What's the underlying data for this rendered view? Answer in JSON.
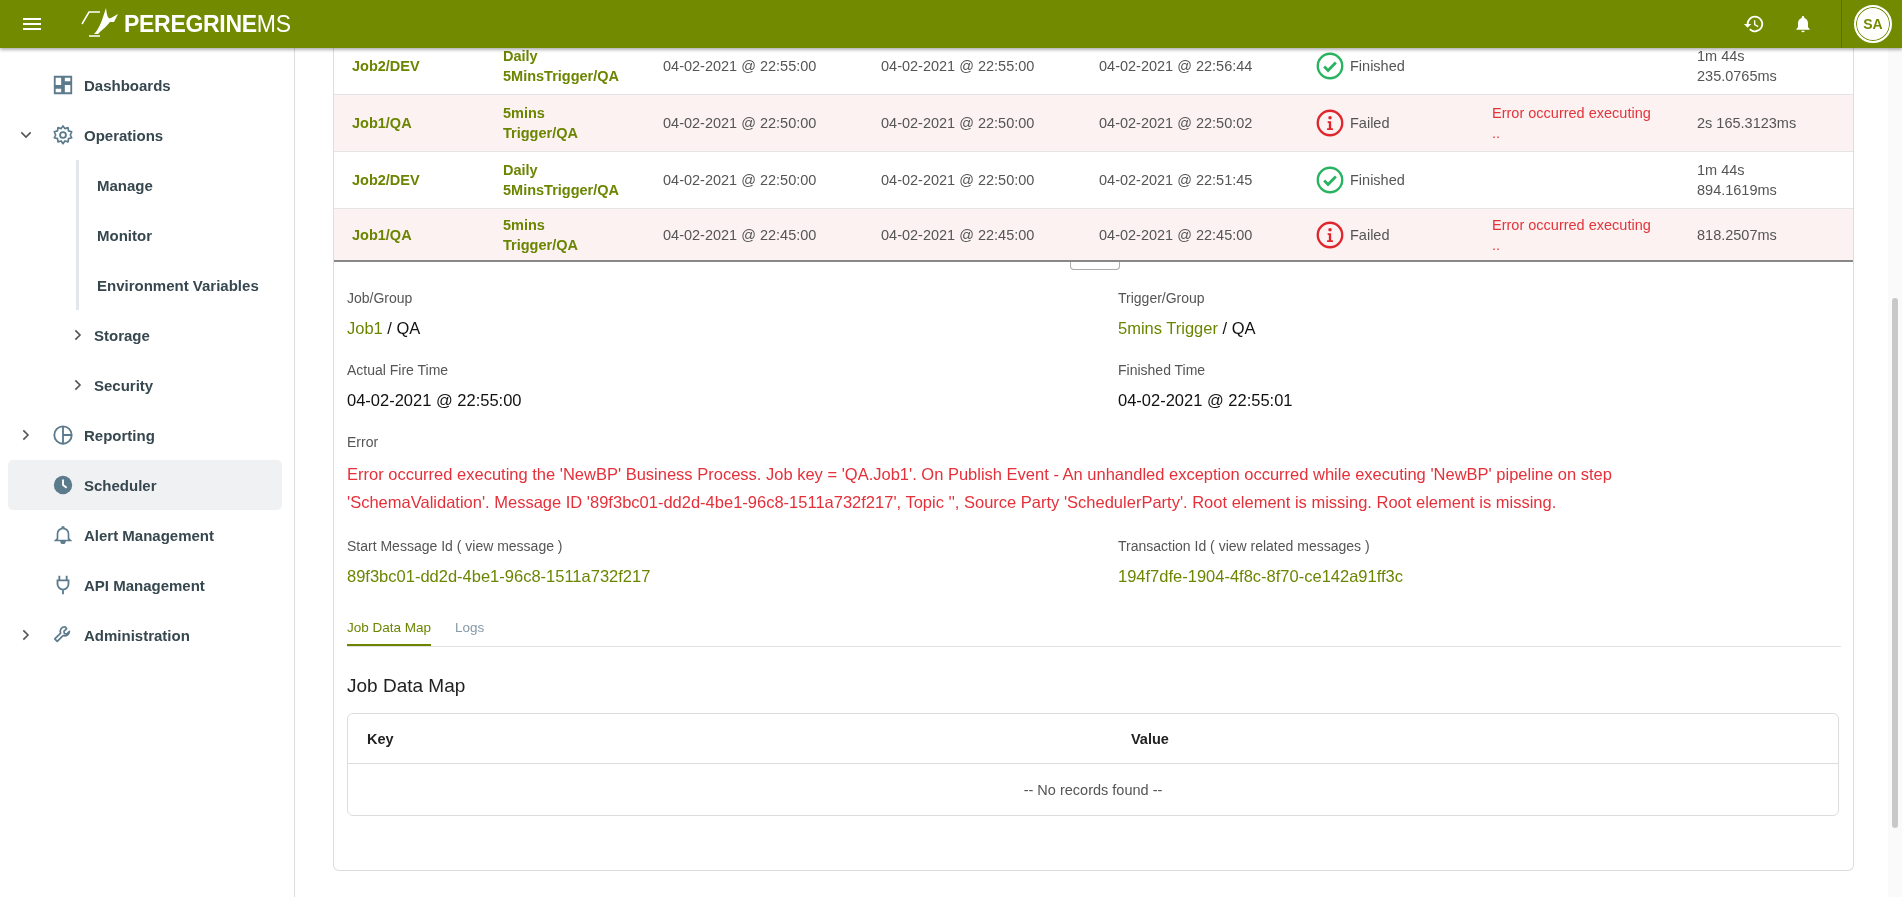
{
  "header": {
    "brand": "PEREGRINE",
    "brand_suffix": "MS",
    "avatar": "SA"
  },
  "sidebar": {
    "items": [
      {
        "label": "Dashboards",
        "selected": false
      },
      {
        "label": "Operations",
        "expanded": true,
        "selected": false,
        "children": [
          {
            "label": "Manage",
            "selected": false
          },
          {
            "label": "Monitor",
            "selected": false
          },
          {
            "label": "Environment Variables",
            "selected": false
          },
          {
            "label": "Storage",
            "expanded": false,
            "selected": false
          },
          {
            "label": "Security",
            "expanded": false,
            "selected": false
          }
        ]
      },
      {
        "label": "Reporting",
        "expanded": false,
        "selected": false
      },
      {
        "label": "Scheduler",
        "selected": true
      },
      {
        "label": "Alert Management",
        "selected": false
      },
      {
        "label": "API Management",
        "selected": false
      },
      {
        "label": "Administration",
        "expanded": false,
        "selected": false
      }
    ]
  },
  "history": {
    "rows": [
      {
        "job": "Job2/DEV",
        "trigger": "Daily 5MinsTrigger/QA",
        "scheduled": "04-02-2021 @ 22:55:00",
        "fired": "04-02-2021 @ 22:55:00",
        "finished": "04-02-2021 @ 22:56:44",
        "kind": "finished",
        "status_label": "Finished",
        "duration": "1m 44s 235.0765ms"
      },
      {
        "job": "Job1/QA",
        "trigger": "5mins Trigger/QA",
        "scheduled": "04-02-2021 @ 22:50:00",
        "fired": "04-02-2021 @ 22:50:00",
        "finished": "04-02-2021 @ 22:50:02",
        "kind": "failed",
        "status_label": "Failed",
        "error": "Error occurred executing ..",
        "duration": "2s 165.3123ms"
      },
      {
        "job": "Job2/DEV",
        "trigger": "Daily 5MinsTrigger/QA",
        "scheduled": "04-02-2021 @ 22:50:00",
        "fired": "04-02-2021 @ 22:50:00",
        "finished": "04-02-2021 @ 22:51:45",
        "kind": "finished",
        "status_label": "Finished",
        "duration": "1m 44s 894.1619ms"
      },
      {
        "job": "Job1/QA",
        "trigger": "5mins Trigger/QA",
        "scheduled": "04-02-2021 @ 22:45:00",
        "fired": "04-02-2021 @ 22:45:00",
        "finished": "04-02-2021 @ 22:45:00",
        "kind": "failed",
        "status_label": "Failed",
        "error": "Error occurred executing ..",
        "duration": "818.2507ms"
      }
    ]
  },
  "detail": {
    "job_group": {
      "label": "Job/Group",
      "link": "Job1",
      "rest": "/ QA"
    },
    "trigger_group": {
      "label": "Trigger/Group",
      "link": "5mins Trigger",
      "rest": "/ QA"
    },
    "actual_fire_time": {
      "label": "Actual Fire Time",
      "value": "04-02-2021 @ 22:55:00"
    },
    "finished_time": {
      "label": "Finished Time",
      "value": "04-02-2021 @ 22:55:01"
    },
    "error": {
      "label": "Error",
      "value": "Error occurred executing the 'NewBP' Business Process. Job key = 'QA.Job1'. On Publish Event - An unhandled exception occurred while executing 'NewBP' pipeline on step 'SchemaValidation'. Message ID '89f3bc01-dd2d-4be1-96c8-1511a732f217', Topic '', Source Party 'SchedulerParty'. Root element is missing. Root element is missing."
    },
    "start_message": {
      "label": "Start Message Id ( view message )",
      "value": "89f3bc01-dd2d-4be1-96c8-1511a732f217"
    },
    "transaction": {
      "label": "Transaction Id ( view related messages )",
      "value": "194f7dfe-1904-4f8c-8f70-ce142a91ff3c"
    }
  },
  "tabs": [
    {
      "label": "Job Data Map",
      "selected": true
    },
    {
      "label": "Logs",
      "selected": false
    }
  ],
  "job_data_map": {
    "title": "Job Data Map",
    "columns": [
      "Key",
      "Value"
    ],
    "empty": "-- No records found --"
  }
}
